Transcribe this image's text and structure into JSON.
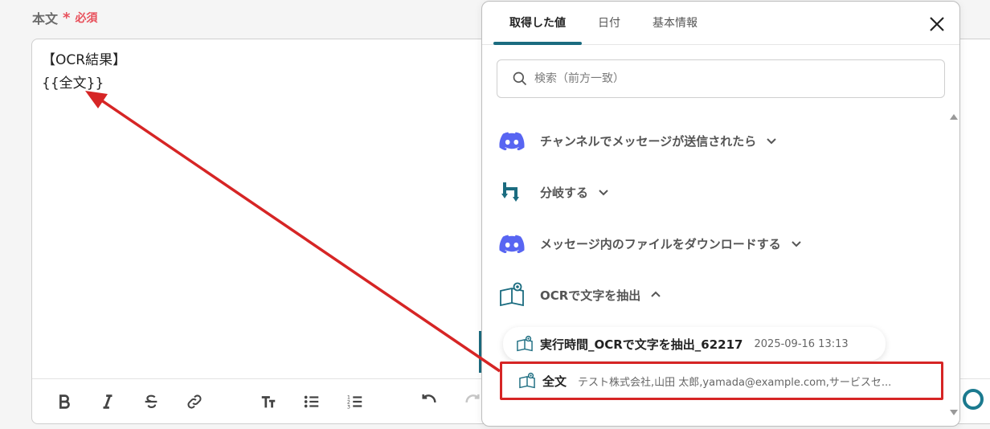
{
  "field": {
    "label": "本文",
    "required_mark": "*",
    "required_text": "必須"
  },
  "editor": {
    "lines": [
      "【OCR結果】",
      "{{全文}}"
    ]
  },
  "panel": {
    "tabs": [
      {
        "label": "取得した値",
        "active": true
      },
      {
        "label": "日付",
        "active": false
      },
      {
        "label": "基本情報",
        "active": false
      }
    ],
    "search_placeholder": "検索（前方一致）",
    "groups": [
      {
        "label": "チャンネルでメッセージが送信されたら",
        "icon": "discord-icon",
        "expanded": false
      },
      {
        "label": "分岐する",
        "icon": "branch-icon",
        "expanded": false
      },
      {
        "label": "メッセージ内のファイルをダウンロードする",
        "icon": "discord-icon",
        "expanded": false
      },
      {
        "label": "OCRで文字を抽出",
        "icon": "ocr-book-icon",
        "expanded": true
      }
    ],
    "items": [
      {
        "name": "実行時間_OCRで文字を抽出_62217",
        "value": "2025-09-16 13:13"
      },
      {
        "name": "全文",
        "value": "テスト株式会社,山田 太郎,yamada@example.com,サービスセ..."
      }
    ]
  },
  "colors": {
    "accent": "#1b6c80",
    "required": "#e8505b",
    "highlight": "#d62525",
    "discord": "#5865f2"
  }
}
